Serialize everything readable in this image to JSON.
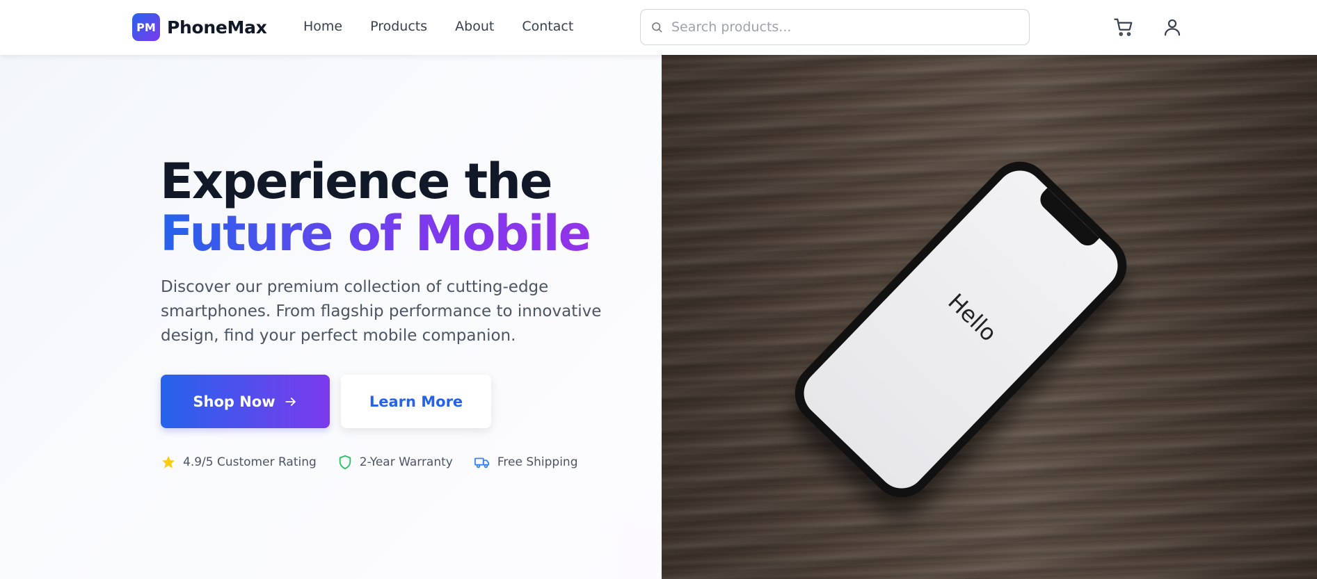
{
  "brand": {
    "logo_initials": "PM",
    "name": "PhoneMax"
  },
  "nav": {
    "items": [
      {
        "label": "Home"
      },
      {
        "label": "Products"
      },
      {
        "label": "About"
      },
      {
        "label": "Contact"
      }
    ]
  },
  "search": {
    "placeholder": "Search products...",
    "icon": "search-icon"
  },
  "header_icons": {
    "cart": "cart-icon",
    "user": "user-icon"
  },
  "hero": {
    "title_line1": "Experience the",
    "title_line2": "Future of Mobile",
    "description": "Discover our premium collection of cutting-edge smartphones. From flagship performance to innovative design, find your perfect mobile companion.",
    "primary_button": "Shop Now",
    "secondary_button": "Learn More",
    "features": [
      {
        "icon": "star-icon",
        "label": "4.9/5 Customer Rating"
      },
      {
        "icon": "shield-icon",
        "label": "2-Year Warranty"
      },
      {
        "icon": "truck-icon",
        "label": "Free Shipping"
      }
    ],
    "image_screen_text": "Hello"
  },
  "colors": {
    "accent_blue": "#2563eb",
    "accent_purple": "#7c3aed",
    "star": "#facc15",
    "shield": "#22c55e",
    "truck": "#3b82f6"
  }
}
